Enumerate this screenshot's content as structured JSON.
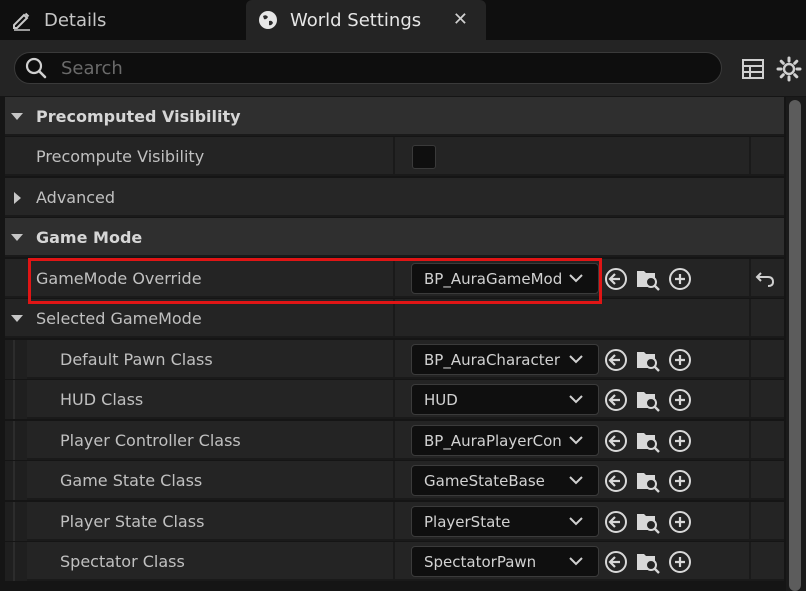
{
  "tabs": {
    "details_label": "Details",
    "world_label": "World Settings",
    "close_glyph": "✕"
  },
  "search": {
    "placeholder": "Search",
    "value": ""
  },
  "toolbar": {
    "table_icon": "table-icon",
    "settings_icon": "gear-icon"
  },
  "sections": {
    "precomputed": {
      "label": "Precomputed Visibility",
      "precompute_label": "Precompute Visibility",
      "precompute_checked": false
    },
    "advanced": {
      "label": "Advanced"
    },
    "game_mode": {
      "label": "Game Mode",
      "override_label": "GameMode Override",
      "override_value": "BP_AuraGameMod",
      "selected_label": "Selected GameMode"
    }
  },
  "selected_gamemode": [
    {
      "label": "Default Pawn Class",
      "value": "BP_AuraCharacter"
    },
    {
      "label": "HUD Class",
      "value": "HUD"
    },
    {
      "label": "Player Controller Class",
      "value": "BP_AuraPlayerCon"
    },
    {
      "label": "Game State Class",
      "value": "GameStateBase"
    },
    {
      "label": "Player State Class",
      "value": "PlayerState"
    },
    {
      "label": "Spectator Class",
      "value": "SpectatorPawn"
    }
  ],
  "colors": {
    "highlight": "#e01515",
    "accent_icon": "#d8d8d8"
  }
}
